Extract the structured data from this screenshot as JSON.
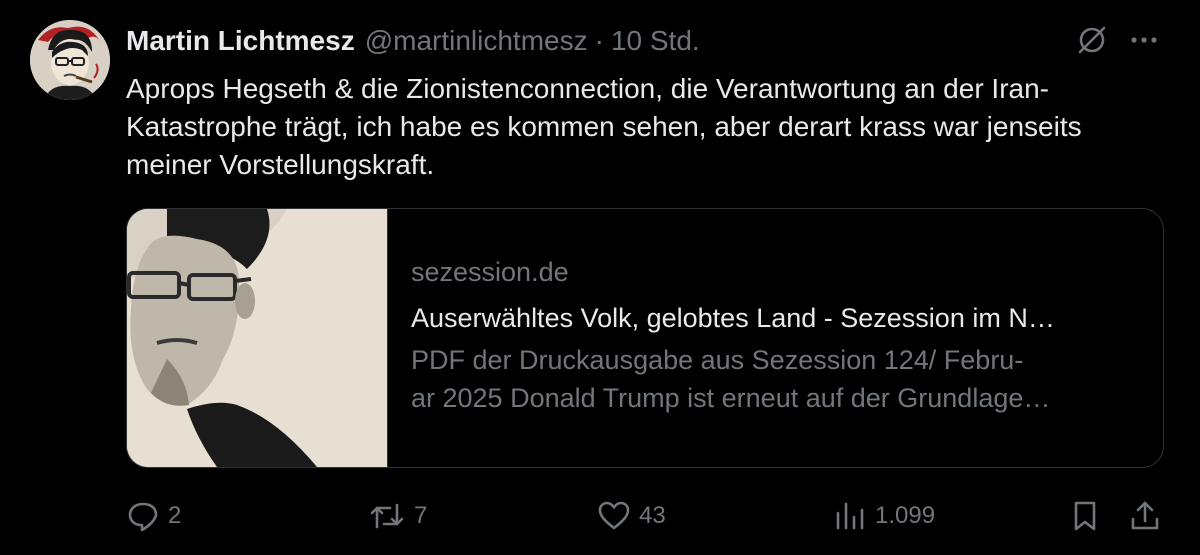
{
  "tweet": {
    "author_name": "Martin Lichtmesz",
    "handle": "@martinlichtmesz",
    "separator": "·",
    "time": "10 Std.",
    "text": "Aprops Hegseth & die Zionistenconnection, die Verantwortung an der Iran-Katastrophe trägt, ich habe es kommen sehen, aber derart krass war jenseits meiner Vorstellungskraft."
  },
  "card": {
    "domain": "sezession.de",
    "title": "Auserwähltes Volk, gelobtes Land - Sezession im N…",
    "description_line1": "PDF der Druckausgabe aus Sezession 124/ Febru-",
    "description_line2": "ar 2025 Donald Trump ist erneut auf der Grundlage…"
  },
  "actions": {
    "replies": "2",
    "reposts": "7",
    "likes": "43",
    "views": "1.099"
  },
  "icons": {
    "header": [
      "grok-icon",
      "more-icon"
    ],
    "actions": [
      "reply-icon",
      "repost-icon",
      "like-icon",
      "views-icon",
      "bookmark-icon",
      "share-icon"
    ]
  },
  "colors": {
    "background": "#000000",
    "text_primary": "#e7e9ea",
    "text_secondary": "#71767b",
    "border": "#2f3336"
  }
}
